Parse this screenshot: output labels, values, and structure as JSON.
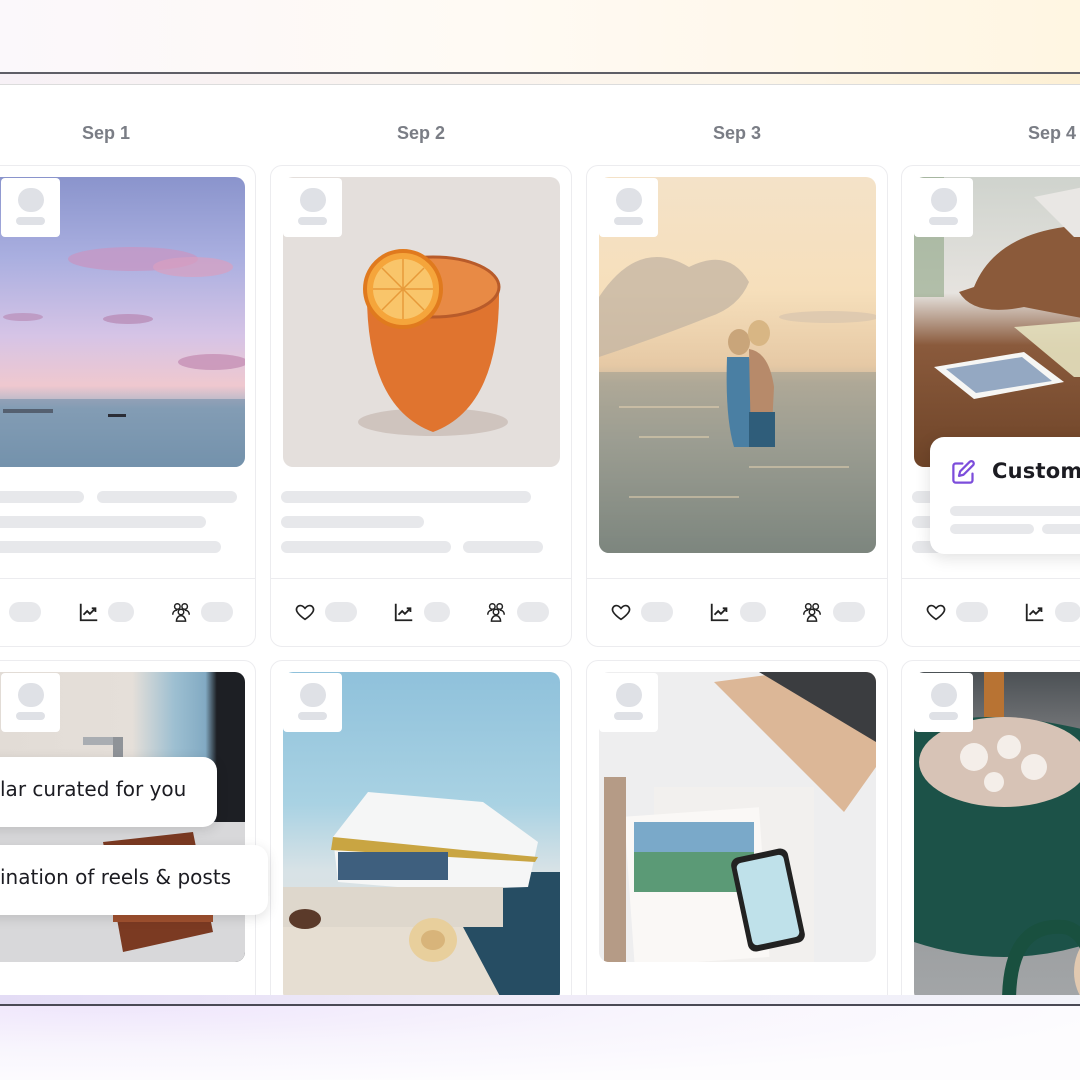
{
  "calendar": {
    "columns": [
      {
        "date": "Sep 1"
      },
      {
        "date": "Sep 2"
      },
      {
        "date": "Sep 3"
      },
      {
        "date": "Sep 4"
      }
    ]
  },
  "posts": [
    {
      "column": "Sep 1",
      "row": 1,
      "image": "sunset-sea-with-boat",
      "stats": [
        "heart-icon",
        "trending-up-icon",
        "group-icon"
      ]
    },
    {
      "column": "Sep 2",
      "row": 1,
      "image": "orange-cocktail-with-dried-orange",
      "stats": [
        "heart-icon",
        "trending-up-icon",
        "group-icon"
      ]
    },
    {
      "column": "Sep 3",
      "row": 1,
      "image": "couple-in-sea-at-sunset",
      "stats": [
        "heart-icon",
        "trending-up-icon",
        "group-icon"
      ]
    },
    {
      "column": "Sep 4",
      "row": 1,
      "image": "person-writing-postcard",
      "stats": [
        "heart-icon",
        "trending-up-icon"
      ]
    },
    {
      "column": "Sep 1",
      "row": 2,
      "image": "bathroom-faucet-and-chair"
    },
    {
      "column": "Sep 2",
      "row": 2,
      "image": "ferry-boat-at-harbor-with-hat"
    },
    {
      "column": "Sep 3",
      "row": 2,
      "image": "travel-magazine-laptop-phone"
    },
    {
      "column": "Sep 4",
      "row": 2,
      "image": "hot-chocolate-green-mug"
    }
  ],
  "overlays": {
    "customize": {
      "label": "Customiz",
      "icon": "edit-icon",
      "accent": "#7c4ddb"
    },
    "curated": {
      "label": "lar curated for you"
    },
    "combination": {
      "label": "ination of reels & posts"
    }
  },
  "colors": {
    "skeleton": "#e7e8eb",
    "date_text": "#7a7d85",
    "accent": "#7c4ddb"
  }
}
